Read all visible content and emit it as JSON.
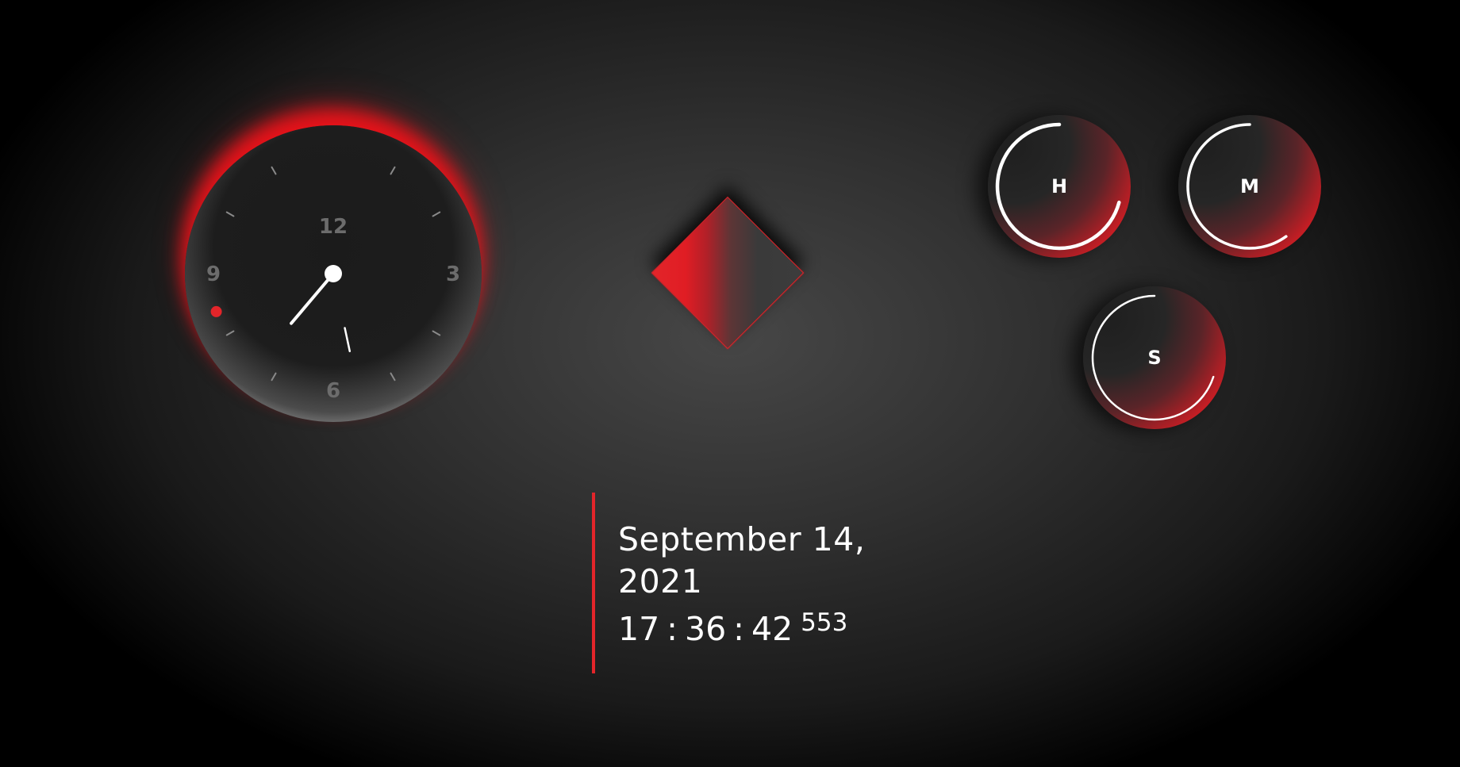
{
  "analog_clock": {
    "numerals": {
      "twelve": "12",
      "three": "3",
      "six": "6",
      "nine": "9"
    },
    "time": {
      "hours": 17,
      "minutes": 36,
      "seconds": 42
    },
    "colors": {
      "accent": "#e3252a",
      "face": "#1d1d1d",
      "numerals": "#6c6c6c",
      "hands": "#ffffff"
    }
  },
  "indicators": {
    "hours": {
      "label": "H",
      "value": 17,
      "max": 24
    },
    "minutes": {
      "label": "M",
      "value": 36,
      "max": 60
    },
    "seconds": {
      "label": "S",
      "value": 42,
      "max": 60
    }
  },
  "digital": {
    "date": "September 14, 2021",
    "hours": "17",
    "minutes": "36",
    "seconds": "42",
    "separator": ":",
    "milliseconds": "553"
  },
  "theme": {
    "accent": "#e3252a",
    "background": "#2f2f2f"
  }
}
